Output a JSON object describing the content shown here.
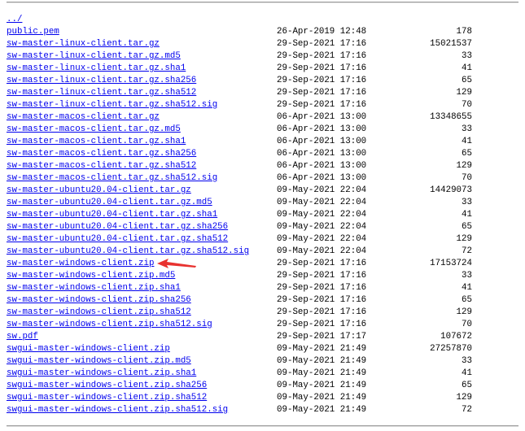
{
  "parent_link": "../",
  "arrow_color": "#e8322f",
  "files": [
    {
      "name": "public.pem",
      "date": "26-Apr-2019 12:48",
      "size": "178"
    },
    {
      "name": "sw-master-linux-client.tar.gz",
      "date": "29-Sep-2021 17:16",
      "size": "15021537"
    },
    {
      "name": "sw-master-linux-client.tar.gz.md5",
      "date": "29-Sep-2021 17:16",
      "size": "33"
    },
    {
      "name": "sw-master-linux-client.tar.gz.sha1",
      "date": "29-Sep-2021 17:16",
      "size": "41"
    },
    {
      "name": "sw-master-linux-client.tar.gz.sha256",
      "date": "29-Sep-2021 17:16",
      "size": "65"
    },
    {
      "name": "sw-master-linux-client.tar.gz.sha512",
      "date": "29-Sep-2021 17:16",
      "size": "129"
    },
    {
      "name": "sw-master-linux-client.tar.gz.sha512.sig",
      "date": "29-Sep-2021 17:16",
      "size": "70"
    },
    {
      "name": "sw-master-macos-client.tar.gz",
      "date": "06-Apr-2021 13:00",
      "size": "13348655"
    },
    {
      "name": "sw-master-macos-client.tar.gz.md5",
      "date": "06-Apr-2021 13:00",
      "size": "33"
    },
    {
      "name": "sw-master-macos-client.tar.gz.sha1",
      "date": "06-Apr-2021 13:00",
      "size": "41"
    },
    {
      "name": "sw-master-macos-client.tar.gz.sha256",
      "date": "06-Apr-2021 13:00",
      "size": "65"
    },
    {
      "name": "sw-master-macos-client.tar.gz.sha512",
      "date": "06-Apr-2021 13:00",
      "size": "129"
    },
    {
      "name": "sw-master-macos-client.tar.gz.sha512.sig",
      "date": "06-Apr-2021 13:00",
      "size": "70"
    },
    {
      "name": "sw-master-ubuntu20.04-client.tar.gz",
      "date": "09-May-2021 22:04",
      "size": "14429073"
    },
    {
      "name": "sw-master-ubuntu20.04-client.tar.gz.md5",
      "date": "09-May-2021 22:04",
      "size": "33"
    },
    {
      "name": "sw-master-ubuntu20.04-client.tar.gz.sha1",
      "date": "09-May-2021 22:04",
      "size": "41"
    },
    {
      "name": "sw-master-ubuntu20.04-client.tar.gz.sha256",
      "date": "09-May-2021 22:04",
      "size": "65"
    },
    {
      "name": "sw-master-ubuntu20.04-client.tar.gz.sha512",
      "date": "09-May-2021 22:04",
      "size": "129"
    },
    {
      "name": "sw-master-ubuntu20.04-client.tar.gz.sha512.sig",
      "date": "09-May-2021 22:04",
      "size": "72"
    },
    {
      "name": "sw-master-windows-client.zip",
      "date": "29-Sep-2021 17:16",
      "size": "17153724"
    },
    {
      "name": "sw-master-windows-client.zip.md5",
      "date": "29-Sep-2021 17:16",
      "size": "33"
    },
    {
      "name": "sw-master-windows-client.zip.sha1",
      "date": "29-Sep-2021 17:16",
      "size": "41"
    },
    {
      "name": "sw-master-windows-client.zip.sha256",
      "date": "29-Sep-2021 17:16",
      "size": "65"
    },
    {
      "name": "sw-master-windows-client.zip.sha512",
      "date": "29-Sep-2021 17:16",
      "size": "129"
    },
    {
      "name": "sw-master-windows-client.zip.sha512.sig",
      "date": "29-Sep-2021 17:16",
      "size": "70"
    },
    {
      "name": "sw.pdf",
      "date": "29-Sep-2021 17:17",
      "size": "107672"
    },
    {
      "name": "swgui-master-windows-client.zip",
      "date": "09-May-2021 21:49",
      "size": "27257870"
    },
    {
      "name": "swgui-master-windows-client.zip.md5",
      "date": "09-May-2021 21:49",
      "size": "33"
    },
    {
      "name": "swgui-master-windows-client.zip.sha1",
      "date": "09-May-2021 21:49",
      "size": "41"
    },
    {
      "name": "swgui-master-windows-client.zip.sha256",
      "date": "09-May-2021 21:49",
      "size": "65"
    },
    {
      "name": "swgui-master-windows-client.zip.sha512",
      "date": "09-May-2021 21:49",
      "size": "129"
    },
    {
      "name": "swgui-master-windows-client.zip.sha512.sig",
      "date": "09-May-2021 21:49",
      "size": "72"
    }
  ]
}
